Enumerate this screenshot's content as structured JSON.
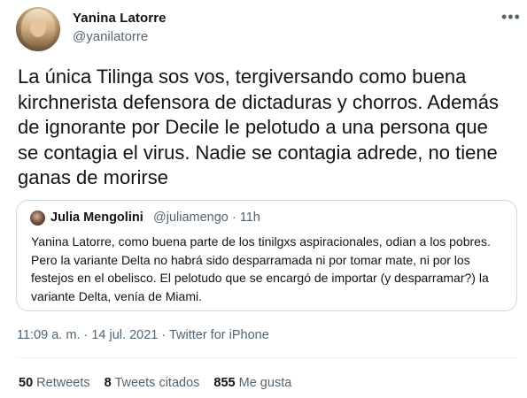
{
  "tweet": {
    "author": {
      "name": "Yanina Latorre",
      "handle": "@yanilatorre"
    },
    "more_icon": "more-horizontal-icon",
    "text": "La única Tilinga sos vos, tergiversando como buena kirchnerista defensora de dictaduras y chorros. Además de ignorante por Decile le pelotudo a una persona que se contagia el virus. Nadie se contagia adrede, no tiene ganas de morirse",
    "quoted": {
      "author_name": "Julia Mengolini",
      "meta": "@juliamengo · 11h",
      "text": "Yanina Latorre, como buena parte de los tinilgxs aspiracionales, odian a los pobres. Pero la variante Delta no habrá sido desparramada ni por tomar mate, ni por los festejos en el obelisco. El pelotudo que se encargó de importar (y desparramar?) la variante Delta, venía de Miami."
    },
    "timestamp": "11:09 a. m. · 14 jul. 2021 · Twitter for iPhone",
    "stats": {
      "retweets_count": "50",
      "retweets_label": "Retweets",
      "quotes_count": "8",
      "quotes_label": "Tweets citados",
      "likes_count": "855",
      "likes_label": "Me gusta"
    }
  }
}
